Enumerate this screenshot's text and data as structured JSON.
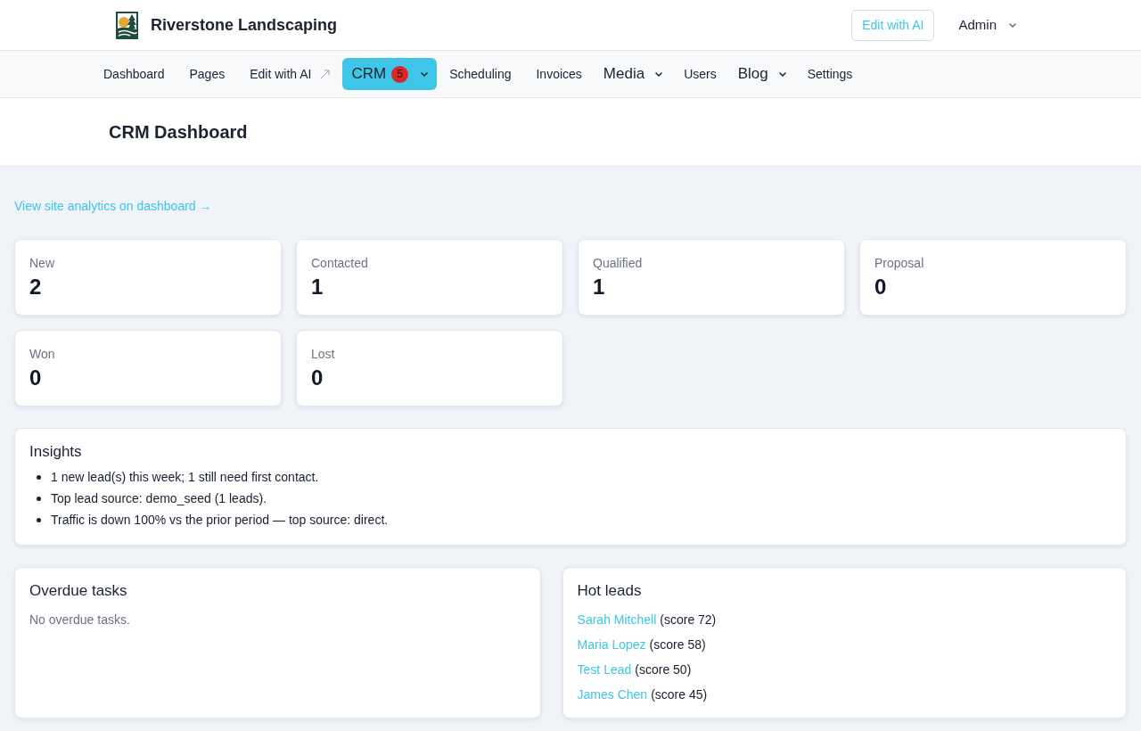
{
  "brand": {
    "name": "Riverstone Landscaping"
  },
  "header_actions": {
    "edit_button": "Edit with AI",
    "user_menu": "Admin"
  },
  "nav": [
    {
      "label": "Dashboard",
      "kind": "link",
      "selected": false
    },
    {
      "label": "Pages",
      "kind": "link",
      "selected": false
    },
    {
      "label": "Edit with AI",
      "kind": "external",
      "selected": false
    },
    {
      "label": "CRM",
      "kind": "dropdown",
      "selected": true,
      "badge": "5"
    },
    {
      "label": "Scheduling",
      "kind": "link",
      "selected": false
    },
    {
      "label": "Invoices",
      "kind": "link",
      "selected": false
    },
    {
      "label": "Media",
      "kind": "dropdown",
      "selected": false
    },
    {
      "label": "Users",
      "kind": "link",
      "selected": false
    },
    {
      "label": "Blog",
      "kind": "dropdown",
      "selected": false
    },
    {
      "label": "Settings",
      "kind": "link",
      "selected": false
    }
  ],
  "page_title": "CRM Dashboard",
  "analytics_link": "View site analytics on dashboard →",
  "stages": [
    {
      "label": "New",
      "count": "2"
    },
    {
      "label": "Contacted",
      "count": "1"
    },
    {
      "label": "Qualified",
      "count": "1"
    },
    {
      "label": "Proposal",
      "count": "0"
    },
    {
      "label": "Won",
      "count": "0"
    },
    {
      "label": "Lost",
      "count": "0"
    }
  ],
  "insights": {
    "title": "Insights",
    "items": [
      "1 new lead(s) this week; 1 still need first contact.",
      "Top lead source: demo_seed (1 leads).",
      "Traffic is down 100% vs the prior period — top source: direct."
    ]
  },
  "overdue_tasks": {
    "title": "Overdue tasks",
    "empty_text": "No overdue tasks."
  },
  "hot_leads": {
    "title": "Hot leads",
    "items": [
      {
        "name": "Sarah Mitchell",
        "score": "(score 72)"
      },
      {
        "name": "Maria Lopez",
        "score": "(score 58)"
      },
      {
        "name": "Test Lead",
        "score": "(score 50)"
      },
      {
        "name": "James Chen",
        "score": "(score 45)"
      }
    ]
  }
}
